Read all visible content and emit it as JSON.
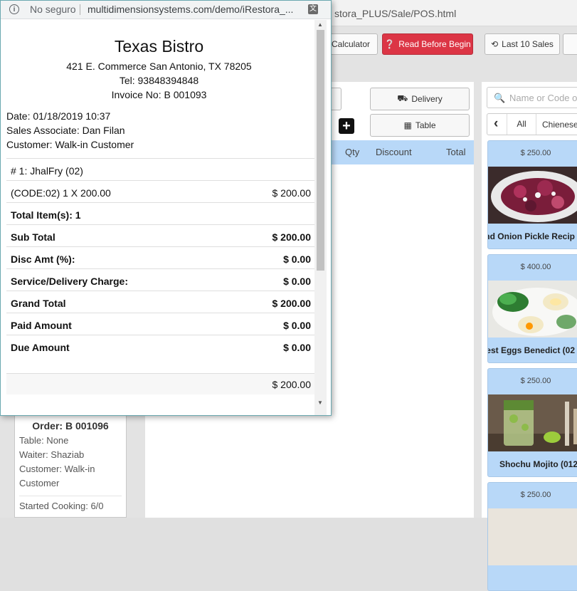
{
  "browser": {
    "security_label": "No seguro",
    "popup_url": "multidimensionsystems.com/demo/iRestora_...",
    "bg_url": "stora_PLUS/Sale/POS.html"
  },
  "toolbar": {
    "calculator": "Calculator",
    "read_before": "Read Before Begin",
    "last_sales": "Last 10 Sales"
  },
  "order_type": {
    "delivery": "Delivery",
    "table": "Table"
  },
  "cart": {
    "qty": "Qty",
    "discount": "Discount",
    "total": "Total"
  },
  "menu": {
    "search_placeholder": "Name or Code o",
    "all": "All",
    "category": "Chienese",
    "items": [
      {
        "price": "$ 250.00",
        "name": "nd Onion Pickle Recip"
      },
      {
        "price": "$ 400.00",
        "name": "est Eggs Benedict (02"
      },
      {
        "price": "$ 250.00",
        "name": "Shochu Mojito (012)"
      },
      {
        "price": "$ 250.00"
      }
    ]
  },
  "order_card": {
    "title": "Order: B 001096",
    "table": "Table: None",
    "waiter": "Waiter: Shaziab",
    "customer": "Customer: Walk-in",
    "customer_cont": "Customer",
    "status": "Started Cooking: 6/0"
  },
  "receipt": {
    "restaurant": "Texas Bistro",
    "address": "421 E. Commerce San Antonio, TX 78205",
    "tel": "Tel: 93848394848",
    "invoice": "Invoice No: B 001093",
    "date": "Date: 01/18/2019 10:37",
    "associate": "Sales Associate: Dan Filan",
    "customer": "Customer: Walk-in Customer",
    "item_line": "# 1:   JhalFry (02)",
    "code_line": "(CODE:02) 1 X 200.00",
    "code_amount": "$ 200.00",
    "total_items": "Total Item(s): 1",
    "sub_total_label": "Sub Total",
    "sub_total": "$ 200.00",
    "disc_label": "Disc Amt (%):",
    "disc": "$ 0.00",
    "service_label": "Service/Delivery Charge:",
    "service": "$ 0.00",
    "grand_label": "Grand Total",
    "grand": "$ 200.00",
    "paid_label": "Paid Amount",
    "paid": "$ 0.00",
    "due_label": "Due Amount",
    "due": "$ 0.00",
    "footer_amount": "$ 200.00"
  }
}
